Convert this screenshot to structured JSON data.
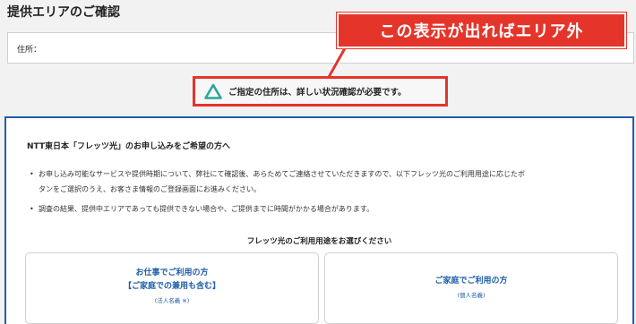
{
  "page": {
    "title": "提供エリアのご確認"
  },
  "address": {
    "label": "住所："
  },
  "callout": {
    "text": "この表示が出ればエリア外",
    "color": "#e5352b"
  },
  "status": {
    "icon": "triangle-icon",
    "icon_color": "#2aa6a0",
    "text": "ご指定の住所は、詳しい状況確認が必要です。"
  },
  "panel": {
    "accent": "#1f5ea8",
    "heading": "NTT東日本「フレッツ光」のお申し込みをご希望の方へ",
    "notes": [
      {
        "line1": "お申し込み可能なサービスや提供時期について、弊社にて確認後、あらためてご連絡させていただきますので、以下フレッツ光のご利用用途に応じたボ",
        "line2": "タンをご選択のうえ、お客さま情報のご登録画面にお進みください。"
      },
      {
        "line1": "調査の結果、提供中エリアであっても提供できない場合や、ご提供までに時間がかかる場合があります。"
      }
    ],
    "choose_heading": "フレッツ光のご利用用途をお選びください",
    "choices": {
      "business": {
        "title_line1": "お仕事でご利用の方",
        "title_line2": "【ご家庭での兼用も含む】",
        "sub": "(法人名義 ※)"
      },
      "home": {
        "title": "ご家庭でご利用の方",
        "sub": "(個人名義)"
      }
    }
  }
}
